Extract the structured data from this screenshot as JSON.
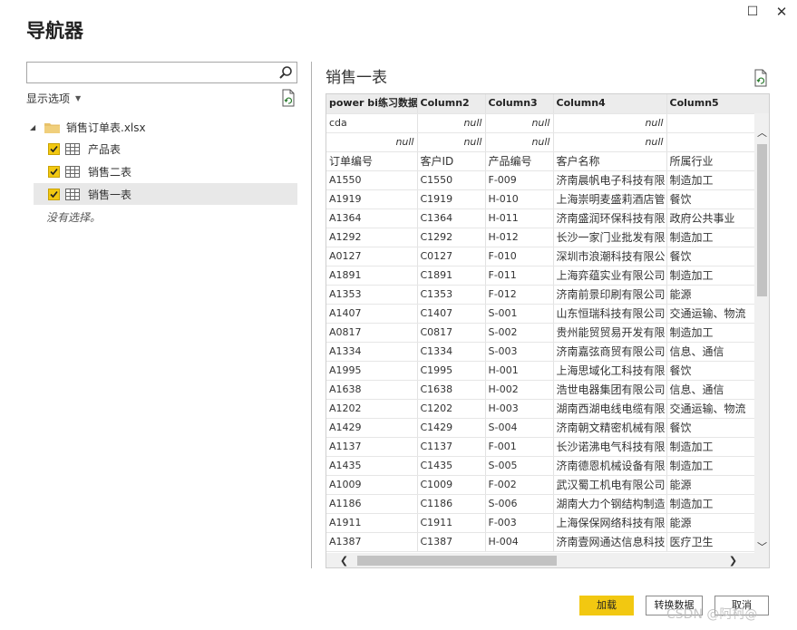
{
  "window": {
    "maximize_glyph": "☐",
    "close_glyph": "✕"
  },
  "dialog_title": "导航器",
  "left_panel": {
    "search_value": "",
    "display_options_label": "显示选项",
    "tree_root_label": "销售订单表.xlsx",
    "items": [
      {
        "label": "产品表",
        "checked": true
      },
      {
        "label": "销售二表",
        "checked": true
      },
      {
        "label": "销售一表",
        "checked": true,
        "selected": true
      }
    ],
    "no_selection_text": "没有选择。"
  },
  "preview": {
    "title": "销售一表",
    "columns": [
      "power bi练习数据",
      "Column2",
      "Column3",
      "Column4",
      "Column5"
    ],
    "rows": [
      [
        "cda",
        "null",
        "null",
        "null",
        ""
      ],
      [
        "null",
        "null",
        "null",
        "null",
        ""
      ],
      [
        "订单编号",
        "客户ID",
        "产品编号",
        "客户名称",
        "所属行业"
      ],
      [
        "A1550",
        "C1550",
        "F-009",
        "济南晨帆电子科技有限",
        "制造加工"
      ],
      [
        "A1919",
        "C1919",
        "H-010",
        "上海崇明麦盛莉酒店管",
        "餐饮"
      ],
      [
        "A1364",
        "C1364",
        "H-011",
        "济南盛润环保科技有限",
        "政府公共事业"
      ],
      [
        "A1292",
        "C1292",
        "H-012",
        "长沙一家门业批发有限",
        "制造加工"
      ],
      [
        "A0127",
        "C0127",
        "F-010",
        "深圳市浪潮科技有限公",
        "餐饮"
      ],
      [
        "A1891",
        "C1891",
        "F-011",
        "上海弈蕴实业有限公司",
        "制造加工"
      ],
      [
        "A1353",
        "C1353",
        "F-012",
        "济南前景印刷有限公司",
        "能源"
      ],
      [
        "A1407",
        "C1407",
        "S-001",
        "山东恒瑞科技有限公司",
        "交通运输、物流"
      ],
      [
        "A0817",
        "C0817",
        "S-002",
        "贵州能贸贸易开发有限",
        "制造加工"
      ],
      [
        "A1334",
        "C1334",
        "S-003",
        "济南嘉弦商贸有限公司",
        "信息、通信"
      ],
      [
        "A1995",
        "C1995",
        "H-001",
        "上海思域化工科技有限",
        "餐饮"
      ],
      [
        "A1638",
        "C1638",
        "H-002",
        "浩世电器集团有限公司",
        "信息、通信"
      ],
      [
        "A1202",
        "C1202",
        "H-003",
        "湖南西湖电线电缆有限",
        "交通运输、物流"
      ],
      [
        "A1429",
        "C1429",
        "S-004",
        "济南朝文精密机械有限",
        "餐饮"
      ],
      [
        "A1137",
        "C1137",
        "F-001",
        "长沙诺沸电气科技有限",
        "制造加工"
      ],
      [
        "A1435",
        "C1435",
        "S-005",
        "济南德恩机械设备有限",
        "制造加工"
      ],
      [
        "A1009",
        "C1009",
        "F-002",
        "武汉蜀工机电有限公司",
        "能源"
      ],
      [
        "A1186",
        "C1186",
        "S-006",
        "湖南大力个钢结构制造",
        "制造加工"
      ],
      [
        "A1911",
        "C1911",
        "F-003",
        "上海保保网络科技有限",
        "能源"
      ],
      [
        "A1387",
        "C1387",
        "H-004",
        "济南壹网通达信息科技",
        "医疗卫生"
      ]
    ]
  },
  "buttons": {
    "load": "加载",
    "transform": "转换数据",
    "cancel": "取消"
  },
  "watermark": "CSDN @阿柯@",
  "colors": {
    "accent": "#f2c811",
    "selected_row": "#e8e8e8",
    "header_bg": "#ececec"
  }
}
